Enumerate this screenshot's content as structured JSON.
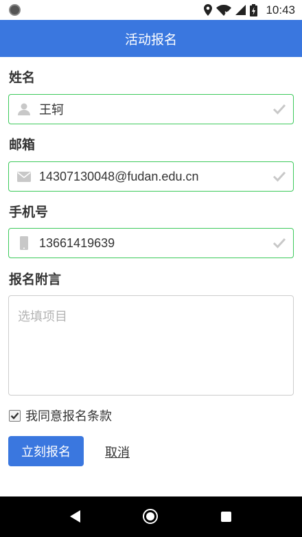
{
  "status_bar": {
    "time": "10:43"
  },
  "app_bar": {
    "title": "活动报名"
  },
  "form": {
    "name": {
      "label": "姓名",
      "value": "王轲",
      "icon": "user-icon"
    },
    "email": {
      "label": "邮箱",
      "value": "14307130048@fudan.edu.cn",
      "icon": "envelope-icon"
    },
    "phone": {
      "label": "手机号",
      "value": "13661419639",
      "icon": "mobile-icon"
    },
    "note": {
      "label": "报名附言",
      "placeholder": "选填项目"
    },
    "agree": {
      "label": "我同意报名条款",
      "checked": true
    }
  },
  "actions": {
    "submit_label": "立刻报名",
    "cancel_label": "取消"
  },
  "colors": {
    "accent": "#3a77df",
    "valid_border": "#3cc95a"
  }
}
